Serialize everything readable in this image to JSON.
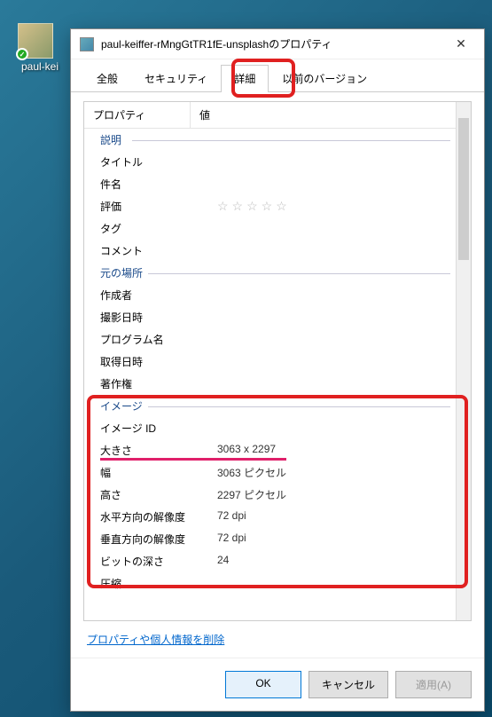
{
  "desktop": {
    "icon_label": "paul-kei"
  },
  "dialog": {
    "title": "paul-keiffer-rMngGtTR1fE-unsplashのプロパティ"
  },
  "tabs": {
    "general": "全般",
    "security": "セキュリティ",
    "details": "詳細",
    "previous": "以前のバージョン"
  },
  "columns": {
    "property": "プロパティ",
    "value": "値"
  },
  "sections": {
    "description": "説明",
    "origin": "元の場所",
    "image": "イメージ"
  },
  "desc": {
    "title_l": "タイトル",
    "title_v": "",
    "subject_l": "件名",
    "subject_v": "",
    "rating_l": "評価",
    "tags_l": "タグ",
    "tags_v": "",
    "comments_l": "コメント",
    "comments_v": ""
  },
  "origin": {
    "authors_l": "作成者",
    "authors_v": "",
    "date_taken_l": "撮影日時",
    "date_taken_v": "",
    "program_l": "プログラム名",
    "program_v": "",
    "date_acq_l": "取得日時",
    "date_acq_v": "",
    "copyright_l": "著作権",
    "copyright_v": ""
  },
  "image": {
    "id_l": "イメージ ID",
    "id_v": "",
    "dim_l": "大きさ",
    "dim_v": "3063 x 2297",
    "width_l": "幅",
    "width_v": "3063 ピクセル",
    "height_l": "高さ",
    "height_v": "2297 ピクセル",
    "hres_l": "水平方向の解像度",
    "hres_v": "72 dpi",
    "vres_l": "垂直方向の解像度",
    "vres_v": "72 dpi",
    "bit_l": "ビットの深さ",
    "bit_v": "24",
    "comp_l": "圧縮",
    "comp_v": ""
  },
  "link": {
    "remove": "プロパティや個人情報を削除"
  },
  "buttons": {
    "ok": "OK",
    "cancel": "キャンセル",
    "apply": "適用(A)"
  }
}
